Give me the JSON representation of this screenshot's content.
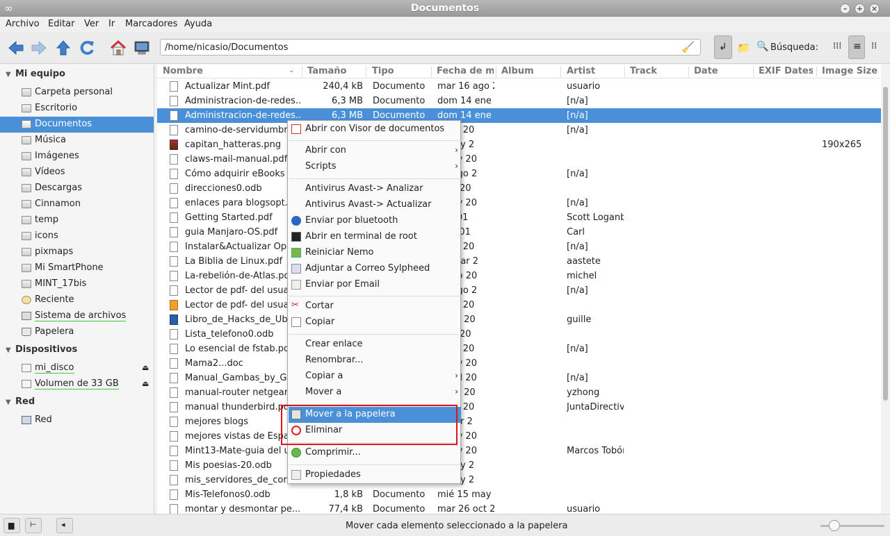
{
  "window": {
    "title": "Documentos"
  },
  "menubar": [
    "Archivo",
    "Editar",
    "Ver",
    "Ir",
    "Marcadores",
    "Ayuda"
  ],
  "toolbar": {
    "path": "/home/nicasio/Documentos",
    "search_label": "Búsqueda:",
    "buttons": [
      "back-arrow-icon",
      "forward-arrow-icon",
      "up-arrow-icon",
      "reload-icon",
      "home-icon",
      "computer-icon"
    ]
  },
  "sidebar": {
    "sections": [
      {
        "title": "Mi equipo"
      },
      {
        "title": "Dispositivos"
      },
      {
        "title": "Red"
      }
    ],
    "items": [
      {
        "label": "Carpeta personal",
        "icon": "home-folder-icon"
      },
      {
        "label": "Escritorio",
        "icon": "desktop-folder-icon"
      },
      {
        "label": "Documentos",
        "icon": "documents-folder-icon"
      },
      {
        "label": "Música",
        "icon": "music-folder-icon"
      },
      {
        "label": "Imágenes",
        "icon": "pictures-folder-icon"
      },
      {
        "label": "Vídeos",
        "icon": "videos-folder-icon"
      },
      {
        "label": "Descargas",
        "icon": "downloads-folder-icon"
      },
      {
        "label": "Cinnamon",
        "icon": "folder-icon"
      },
      {
        "label": "temp",
        "icon": "folder-icon"
      },
      {
        "label": "icons",
        "icon": "folder-icon"
      },
      {
        "label": "pixmaps",
        "icon": "folder-icon"
      },
      {
        "label": "Mi SmartPhone",
        "icon": "folder-icon"
      },
      {
        "label": "MINT_17bis",
        "icon": "folder-icon"
      },
      {
        "label": "Reciente",
        "icon": "clock-icon"
      },
      {
        "label": "Sistema de archivos",
        "icon": "filesystem-icon"
      },
      {
        "label": "Papelera",
        "icon": "trash-icon"
      },
      {
        "label": "mi_disco",
        "icon": "drive-icon"
      },
      {
        "label": "Volumen de 33 GB",
        "icon": "drive-icon"
      },
      {
        "label": "Red",
        "icon": "network-icon"
      }
    ]
  },
  "columns": [
    "Nombre",
    "Tamaño",
    "Tipo",
    "Fecha de m",
    "Album",
    "Artist",
    "Track",
    "Date",
    "EXIF Datest",
    "Image Size"
  ],
  "files": [
    {
      "name": "Actualizar Mint.pdf",
      "size": "240,4 kB",
      "type": "Documento",
      "date": "mar 16 ago 2",
      "artist": "usuario",
      "image_size": ""
    },
    {
      "name": "Administracion-de-redes...",
      "size": "6,3 MB",
      "type": "Documento",
      "date": "dom 14 ene 2",
      "artist": "[n/a]",
      "image_size": ""
    },
    {
      "name": "Administracion-de-redes...",
      "size": "6,3 MB",
      "type": "Documento",
      "date": "dom 14 ene 2",
      "artist": "[n/a]",
      "image_size": ""
    },
    {
      "name": "camino-de-servidumbre-",
      "size": "",
      "type": "",
      "date": "3 oct 20",
      "artist": "[n/a]",
      "image_size": ""
    },
    {
      "name": "capitan_hatteras.png",
      "size": "",
      "type": "",
      "date": "5 may 2",
      "artist": "",
      "image_size": "190x265"
    },
    {
      "name": "claws-mail-manual.pdf",
      "size": "",
      "type": "",
      "date": "2 nov 20",
      "artist": "",
      "image_size": ""
    },
    {
      "name": "Cómo adquirir eBooks e...",
      "size": "",
      "type": "",
      "date": "01 ago 2",
      "artist": "[n/a]",
      "image_size": ""
    },
    {
      "name": "direcciones0.odb",
      "size": "",
      "type": "",
      "date": "3 jul 20",
      "artist": "",
      "image_size": ""
    },
    {
      "name": "enlaces para blogsopt.pc",
      "size": "",
      "type": "",
      "date": "7 nov 20",
      "artist": "[n/a]",
      "image_size": ""
    },
    {
      "name": "Getting Started.pdf",
      "size": "",
      "type": "",
      "date": "jul 201",
      "artist": "Scott Loganb",
      "image_size": ""
    },
    {
      "name": "guia Manjaro-OS.pdf",
      "size": "",
      "type": "",
      "date": "dic 201",
      "artist": "Carl",
      "image_size": ""
    },
    {
      "name": "Instalar&Actualizar Open",
      "size": "",
      "type": "",
      "date": "3 oct 20",
      "artist": "[n/a]",
      "image_size": ""
    },
    {
      "name": "La Biblia de Linux.pdf",
      "size": "",
      "type": "",
      "date": "27 mar 2",
      "artist": "aastete",
      "image_size": ""
    },
    {
      "name": "La-rebelión-de-Atlas.pdf",
      "size": "",
      "type": "",
      "date": "1 ago 20",
      "artist": "michel",
      "image_size": ""
    },
    {
      "name": "Lector de pdf- del usuari",
      "size": "",
      "type": "",
      "date": "01 ago 2",
      "artist": "[n/a]",
      "image_size": ""
    },
    {
      "name": "Lector de pdf- del usuari",
      "size": "",
      "type": "",
      "date": "1 oct 20",
      "artist": "",
      "image_size": ""
    },
    {
      "name": "Libro_de_Hacks_de_Ubu",
      "size": "",
      "type": "",
      "date": "3 abr 20",
      "artist": "guille",
      "image_size": ""
    },
    {
      "name": "Lista_telefono0.odb",
      "size": "",
      "type": "",
      "date": "3 jul 20",
      "artist": "",
      "image_size": ""
    },
    {
      "name": "Lo esencial de fstab.pdf",
      "size": "",
      "type": "",
      "date": "3 oct 20",
      "artist": "[n/a]",
      "image_size": ""
    },
    {
      "name": "Mama2...doc",
      "size": "",
      "type": "",
      "date": "6 nov 20",
      "artist": "",
      "image_size": ""
    },
    {
      "name": "Manual_Gambas_by_GA.",
      "size": "",
      "type": "",
      "date": "18 jul 20",
      "artist": "[n/a]",
      "image_size": ""
    },
    {
      "name": "manual-router netgear.pc",
      "size": "",
      "type": "",
      "date": "6 abr 20",
      "artist": "yzhong",
      "image_size": ""
    },
    {
      "name": "manual thunderbird.pdf",
      "size": "",
      "type": "",
      "date": "3 oct 20",
      "artist": "JuntaDirectiva",
      "image_size": ""
    },
    {
      "name": "mejores blogs",
      "size": "",
      "type": "",
      "date": "5 mar 2",
      "artist": "",
      "image_size": ""
    },
    {
      "name": "mejores vistas de España",
      "size": "",
      "type": "",
      "date": "3 nov 20",
      "artist": "",
      "image_size": ""
    },
    {
      "name": "Mint13-Mate-guia del us.",
      "size": "",
      "type": "",
      "date": "2 nov 20",
      "artist": "Marcos Tobón",
      "image_size": ""
    },
    {
      "name": "Mis poesias-20.odb",
      "size": "",
      "type": "",
      "date": "5 may 2",
      "artist": "",
      "image_size": ""
    },
    {
      "name": "mis_servidores_de_corre",
      "size": "",
      "type": "",
      "date": "1 may 2",
      "artist": "",
      "image_size": ""
    },
    {
      "name": "Mis-Telefonos0.odb",
      "size": "1,8 kB",
      "type": "Documento",
      "date": "mié 15 may 2",
      "artist": "",
      "image_size": ""
    },
    {
      "name": "montar y desmontar pe...",
      "size": "77,4 kB",
      "type": "Documento",
      "date": "mar 26 oct 20",
      "artist": "usuario",
      "image_size": ""
    }
  ],
  "context_menu": [
    {
      "label": "Abrir con Visor de documentos",
      "icon": "document-viewer-icon"
    },
    {
      "label": "Abrir con",
      "submenu": "›"
    },
    {
      "label": "Scripts",
      "submenu": "›"
    },
    {
      "label": "Antivirus Avast-> Analizar"
    },
    {
      "label": "Antivirus Avast-> Actualizar"
    },
    {
      "label": "Enviar por bluetooth",
      "icon": "bluetooth-icon"
    },
    {
      "label": "Abrir en terminal de root",
      "icon": "terminal-icon"
    },
    {
      "label": "Reiniciar Nemo",
      "icon": "folder-green-icon"
    },
    {
      "label": "Adjuntar a Correo Sylpheed",
      "icon": "mail-attach-icon"
    },
    {
      "label": "Enviar por Email",
      "icon": "email-icon"
    },
    {
      "label": "Cortar",
      "icon": "scissors-icon"
    },
    {
      "label": "Copiar",
      "icon": "copy-icon"
    },
    {
      "label": "Crear enlace"
    },
    {
      "label": "Renombrar..."
    },
    {
      "label": "Copiar a",
      "submenu": "›"
    },
    {
      "label": "Mover a",
      "submenu": "›"
    },
    {
      "label": "Mover a la papelera",
      "icon": "trash-icon"
    },
    {
      "label": "Eliminar",
      "icon": "delete-icon"
    },
    {
      "label": "Comprimir...",
      "icon": "archive-icon"
    },
    {
      "label": "Propiedades",
      "icon": "properties-icon"
    }
  ],
  "statusbar": {
    "text": "Mover cada elemento seleccionado a la papelera"
  },
  "colors": {
    "selection": "#4a90d9",
    "highlight_box": "#e0121b"
  }
}
